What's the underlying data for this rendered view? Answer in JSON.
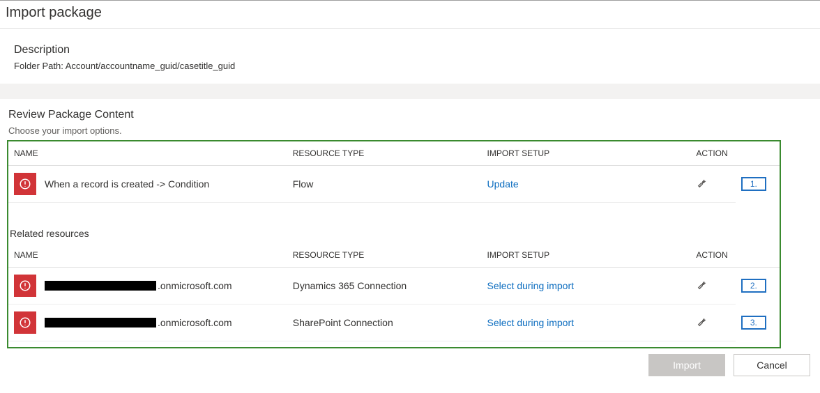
{
  "page": {
    "title": "Import package"
  },
  "description": {
    "heading": "Description",
    "folder_path": "Folder Path: Account/accountname_guid/casetitle_guid"
  },
  "review": {
    "title": "Review Package Content",
    "subtitle": "Choose your import options.",
    "columns": {
      "name": "NAME",
      "resource_type": "RESOURCE TYPE",
      "import_setup": "IMPORT SETUP",
      "action": "ACTION"
    },
    "rows": [
      {
        "name": "When a record is created -> Condition",
        "resource_type": "Flow",
        "import_setup": "Update",
        "callout": "1."
      }
    ]
  },
  "related": {
    "title": "Related resources",
    "columns": {
      "name": "NAME",
      "resource_type": "RESOURCE TYPE",
      "import_setup": "IMPORT SETUP",
      "action": "ACTION"
    },
    "rows": [
      {
        "domain": ".onmicrosoft.com",
        "resource_type": "Dynamics 365 Connection",
        "import_setup": "Select during import",
        "callout": "2."
      },
      {
        "domain": ".onmicrosoft.com",
        "resource_type": "SharePoint Connection",
        "import_setup": "Select during import",
        "callout": "3."
      }
    ]
  },
  "footer": {
    "import_label": "Import",
    "cancel_label": "Cancel"
  }
}
